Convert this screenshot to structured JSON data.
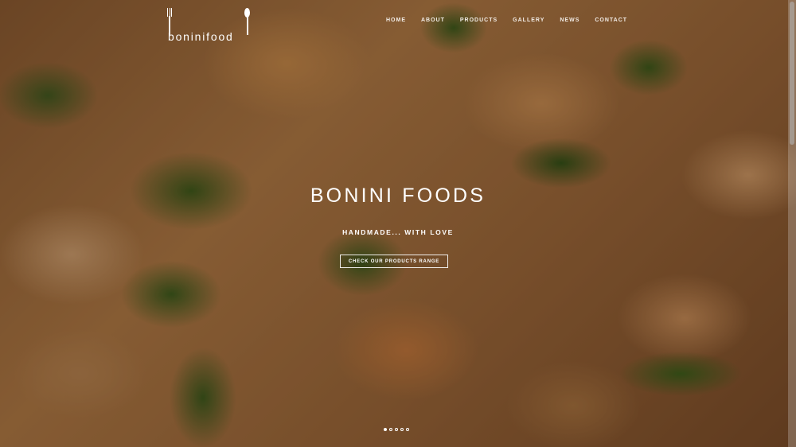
{
  "brand": {
    "logo_text": "boninifood"
  },
  "nav": {
    "items": [
      "HOME",
      "ABOUT",
      "PRODUCTS",
      "GALLERY",
      "NEWS",
      "CONTACT"
    ]
  },
  "hero": {
    "title": "BONINI FOODS",
    "subtitle": "HANDMADE... WITH LOVE",
    "cta_label": "CHECK OUR PRODUCTS RANGE",
    "slider_count": 5,
    "active_slide": 1
  },
  "colors": {
    "text": "#ffffff",
    "pastry": "#c78a4a",
    "spinach": "#3b5a1a"
  }
}
